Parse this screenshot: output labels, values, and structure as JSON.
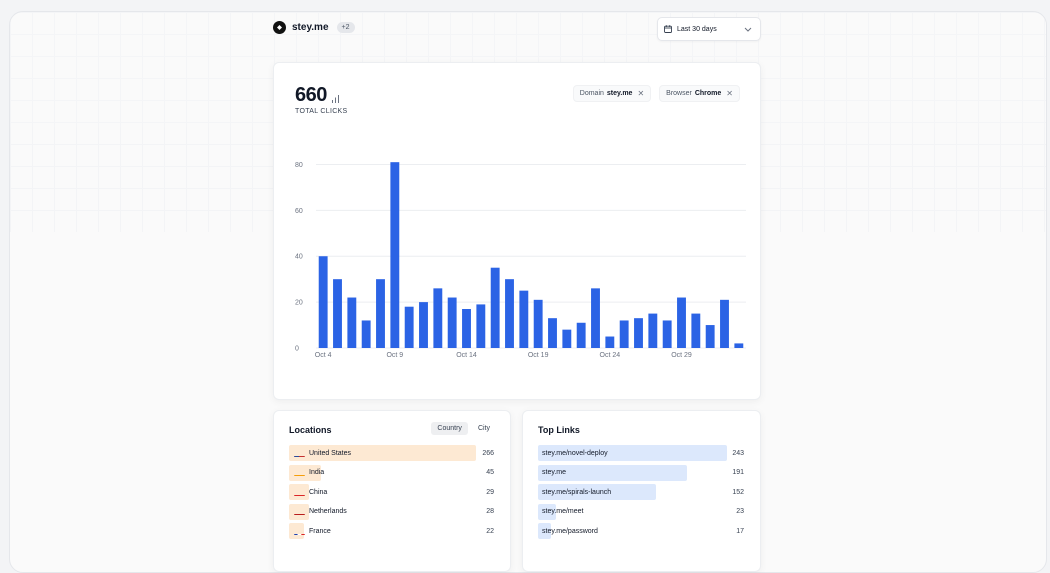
{
  "brand": {
    "name": "stey.me",
    "badge": "+2"
  },
  "date_range": {
    "label": "Last 30 days"
  },
  "summary": {
    "total_value": "660",
    "total_label": "TOTAL CLICKS"
  },
  "filters": [
    {
      "key": "Domain",
      "value": "stey.me"
    },
    {
      "key": "Browser",
      "value": "Chrome"
    }
  ],
  "chart_data": {
    "type": "bar",
    "x": [
      "Oct 4",
      "Oct 5",
      "Oct 6",
      "Oct 7",
      "Oct 8",
      "Oct 9",
      "Oct 10",
      "Oct 11",
      "Oct 12",
      "Oct 13",
      "Oct 14",
      "Oct 15",
      "Oct 16",
      "Oct 17",
      "Oct 18",
      "Oct 19",
      "Oct 20",
      "Oct 21",
      "Oct 22",
      "Oct 23",
      "Oct 24",
      "Oct 25",
      "Oct 26",
      "Oct 27",
      "Oct 28",
      "Oct 29",
      "Oct 30",
      "Oct 31",
      "Nov 1",
      "Nov 2",
      "Nov 3"
    ],
    "values": [
      40,
      30,
      22,
      12,
      30,
      81,
      18,
      20,
      26,
      22,
      17,
      19,
      35,
      30,
      25,
      21,
      13,
      8,
      11,
      26,
      5,
      12,
      13,
      15,
      12,
      22,
      15,
      10,
      21,
      2
    ],
    "xticks": [
      "Oct 4",
      "Oct 9",
      "Oct 14",
      "Oct 19",
      "Oct 24",
      "Oct 29"
    ],
    "yticks": [
      0,
      20,
      40,
      60,
      80
    ],
    "ylim": [
      0,
      85
    ],
    "grid": true,
    "color": "#2b63e5"
  },
  "locations": {
    "title": "Locations",
    "tabs": [
      "Country",
      "City"
    ],
    "active_tab": "Country",
    "bar_color": "#fde9d3",
    "rows": [
      {
        "name": "United States",
        "count": "266",
        "value": 266,
        "flag": "us-flag"
      },
      {
        "name": "India",
        "count": "45",
        "value": 45,
        "flag": "india-flag"
      },
      {
        "name": "China",
        "count": "29",
        "value": 29,
        "flag": "china-flag"
      },
      {
        "name": "Netherlands",
        "count": "28",
        "value": 28,
        "flag": "netherlands-flag"
      },
      {
        "name": "France",
        "count": "22",
        "value": 22,
        "flag": "france-flag"
      }
    ]
  },
  "top_links": {
    "title": "Top Links",
    "bar_color": "#dce8fc",
    "rows": [
      {
        "name": "stey.me/novel-deploy",
        "count": "243",
        "value": 243
      },
      {
        "name": "stey.me",
        "count": "191",
        "value": 191
      },
      {
        "name": "stey.me/spirals-launch",
        "count": "152",
        "value": 152
      },
      {
        "name": "stey.me/meet",
        "count": "23",
        "value": 23
      },
      {
        "name": "stey.me/password",
        "count": "17",
        "value": 17
      }
    ]
  }
}
